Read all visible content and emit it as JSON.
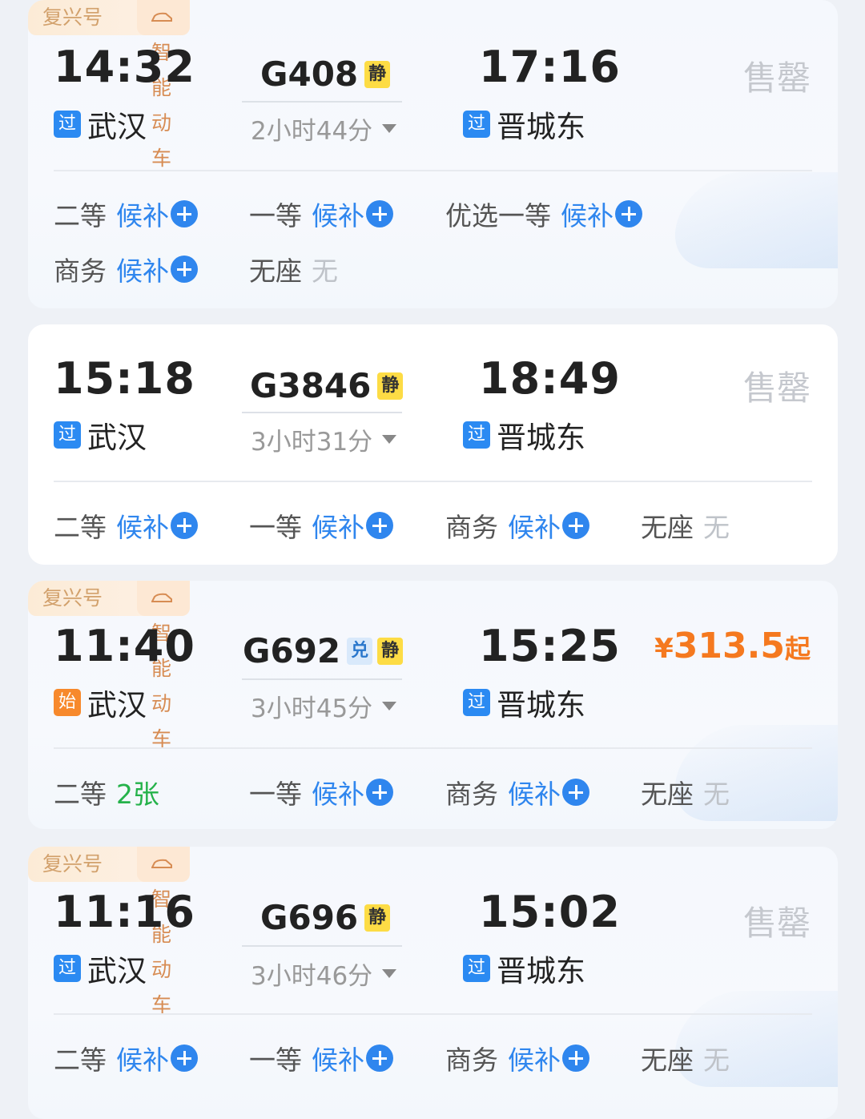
{
  "trains": [
    {
      "brand_tag": "复兴号",
      "smart_tag": "智能动车",
      "depart_time": "14:32",
      "depart_badge": "过",
      "depart_station": "武汉",
      "train_no": "G408",
      "badges": [
        "静"
      ],
      "duration": "2小时44分",
      "arrive_time": "17:16",
      "arrive_badge": "过",
      "arrive_station": "晋城东",
      "status": "售罄",
      "seats": [
        {
          "cls": "二等",
          "state": "候补"
        },
        {
          "cls": "一等",
          "state": "候补"
        },
        {
          "cls": "优选一等",
          "state": "候补"
        },
        {
          "cls": "商务",
          "state": "候补"
        },
        {
          "cls": "无座",
          "state": "无"
        }
      ]
    },
    {
      "depart_time": "15:18",
      "depart_badge": "过",
      "depart_station": "武汉",
      "train_no": "G3846",
      "badges": [
        "静"
      ],
      "duration": "3小时31分",
      "arrive_time": "18:49",
      "arrive_badge": "过",
      "arrive_station": "晋城东",
      "status": "售罄",
      "seats": [
        {
          "cls": "二等",
          "state": "候补"
        },
        {
          "cls": "一等",
          "state": "候补"
        },
        {
          "cls": "商务",
          "state": "候补"
        },
        {
          "cls": "无座",
          "state": "无"
        }
      ]
    },
    {
      "brand_tag": "复兴号",
      "smart_tag": "智能动车",
      "depart_time": "11:40",
      "depart_badge": "始",
      "depart_station": "武汉",
      "train_no": "G692",
      "badges": [
        "兑",
        "静"
      ],
      "duration": "3小时45分",
      "arrive_time": "15:25",
      "arrive_badge": "过",
      "arrive_station": "晋城东",
      "price": {
        "currency": "¥",
        "amount": "313.5",
        "suffix": "起"
      },
      "seats": [
        {
          "cls": "二等",
          "state": "2张"
        },
        {
          "cls": "一等",
          "state": "候补"
        },
        {
          "cls": "商务",
          "state": "候补"
        },
        {
          "cls": "无座",
          "state": "无"
        }
      ]
    },
    {
      "brand_tag": "复兴号",
      "smart_tag": "智能动车",
      "depart_time": "11:16",
      "depart_badge": "过",
      "depart_station": "武汉",
      "train_no": "G696",
      "badges": [
        "静"
      ],
      "duration": "3小时46分",
      "arrive_time": "15:02",
      "arrive_badge": "过",
      "arrive_station": "晋城东",
      "status": "售罄",
      "seats": [
        {
          "cls": "二等",
          "state": "候补"
        },
        {
          "cls": "一等",
          "state": "候补"
        },
        {
          "cls": "商务",
          "state": "候补"
        },
        {
          "cls": "无座",
          "state": "无"
        }
      ]
    }
  ],
  "colors": {
    "waitlist": "#2f86ee",
    "available": "#25b24a",
    "price": "#f5791f",
    "sold_out": "#c5c8ce",
    "quiet_badge": "#fddc45",
    "pass_badge": "#2b8af2",
    "origin_badge": "#f7892c"
  }
}
